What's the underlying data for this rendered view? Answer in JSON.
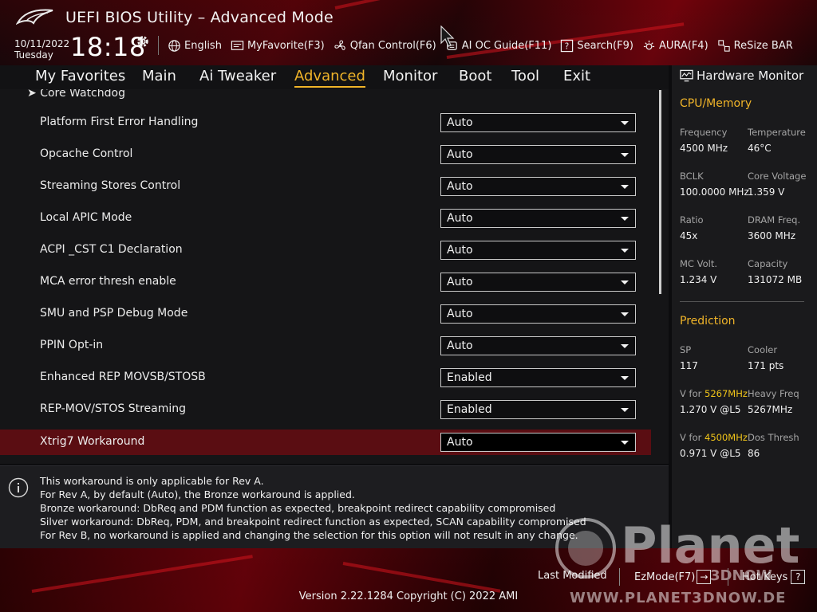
{
  "app": {
    "title": "UEFI BIOS Utility – Advanced Mode",
    "date": "10/11/2022",
    "day": "Tuesday",
    "time": "18:18"
  },
  "toolbar": [
    {
      "label": "English",
      "icon": "globe-icon"
    },
    {
      "label": "MyFavorite(F3)",
      "icon": "favorite-icon"
    },
    {
      "label": "Qfan Control(F6)",
      "icon": "fan-icon"
    },
    {
      "label": "AI OC Guide(F11)",
      "icon": "oc-guide-icon"
    },
    {
      "label": "Search(F9)",
      "icon": "search-icon"
    },
    {
      "label": "AURA(F4)",
      "icon": "aura-icon"
    },
    {
      "label": "ReSize BAR",
      "icon": "resize-bar-icon"
    }
  ],
  "tabs": [
    {
      "label": "My Favorites"
    },
    {
      "label": "Main"
    },
    {
      "label": "Ai Tweaker"
    },
    {
      "label": "Advanced",
      "active": true
    },
    {
      "label": "Monitor"
    },
    {
      "label": "Boot"
    },
    {
      "label": "Tool"
    },
    {
      "label": "Exit"
    }
  ],
  "main": {
    "partial_item": "Core Watchdog",
    "rows": [
      {
        "label": "Platform First Error Handling",
        "value": "Auto"
      },
      {
        "label": "Opcache Control",
        "value": "Auto"
      },
      {
        "label": "Streaming Stores Control",
        "value": "Auto"
      },
      {
        "label": "Local APIC Mode",
        "value": "Auto"
      },
      {
        "label": "ACPI _CST C1 Declaration",
        "value": "Auto"
      },
      {
        "label": "MCA error thresh enable",
        "value": "Auto"
      },
      {
        "label": "SMU and PSP Debug Mode",
        "value": "Auto"
      },
      {
        "label": "PPIN Opt-in",
        "value": "Auto"
      },
      {
        "label": "Enhanced REP MOVSB/STOSB",
        "value": "Enabled"
      },
      {
        "label": "REP-MOV/STOS Streaming",
        "value": "Enabled"
      },
      {
        "label": "Xtrig7 Workaround",
        "value": "Auto",
        "selected": true
      }
    ]
  },
  "info": {
    "lines": [
      "This workaround is only applicable for Rev A.",
      "For Rev A, by default (Auto), the Bronze workaround is applied.",
      "Bronze workaround: DbReq and PDM function as expected, breakpoint redirect capability compromised",
      "Silver workaround: DbReq, PDM, and breakpoint redirect function as expected, SCAN capability compromised",
      "For Rev B, no workaround is applied and changing the selection for this option will not result in any change."
    ]
  },
  "hardware_monitor": {
    "title": "Hardware Monitor",
    "cpu_memory": {
      "title": "CPU/Memory",
      "frequency_label": "Frequency",
      "frequency": "4500 MHz",
      "temperature_label": "Temperature",
      "temperature": "46°C",
      "bclk_label": "BCLK",
      "bclk": "100.0000 MHz",
      "core_voltage_label": "Core Voltage",
      "core_voltage": "1.359 V",
      "ratio_label": "Ratio",
      "ratio": "45x",
      "dram_freq_label": "DRAM Freq.",
      "dram_freq": "3600 MHz",
      "mc_volt_label": "MC Volt.",
      "mc_volt": "1.234 V",
      "capacity_label": "Capacity",
      "capacity": "131072 MB"
    },
    "prediction": {
      "title": "Prediction",
      "sp_label": "SP",
      "sp": "117",
      "cooler_label": "Cooler",
      "cooler": "171 pts",
      "v_for_1_prefix": "V for ",
      "v_for_1_freq": "5267MHz",
      "v_for_1": "1.270 V @L5",
      "heavy_freq_label": "Heavy Freq",
      "heavy_freq": "5267MHz",
      "v_for_2_prefix": "V for ",
      "v_for_2_freq": "4500MHz",
      "v_for_2": "0.971 V @L5",
      "dos_thresh_label": "Dos Thresh",
      "dos_thresh": "86"
    }
  },
  "footer": {
    "last_modified": "Last Modified",
    "ezmode": "EzMode(F7)",
    "hotkeys": "Hot Keys",
    "hotkeys_key": "?",
    "version": "Version 2.22.1284 Copyright (C) 2022 AMI"
  },
  "watermark": {
    "brand": "Planet",
    "brand_sub": "3DNOW",
    "url": "WWW.PLANET3DNOW.DE"
  },
  "colors": {
    "accent": "#f0b429",
    "selected_row": "#5a0d12",
    "highlight_freq": "#f0c419"
  }
}
